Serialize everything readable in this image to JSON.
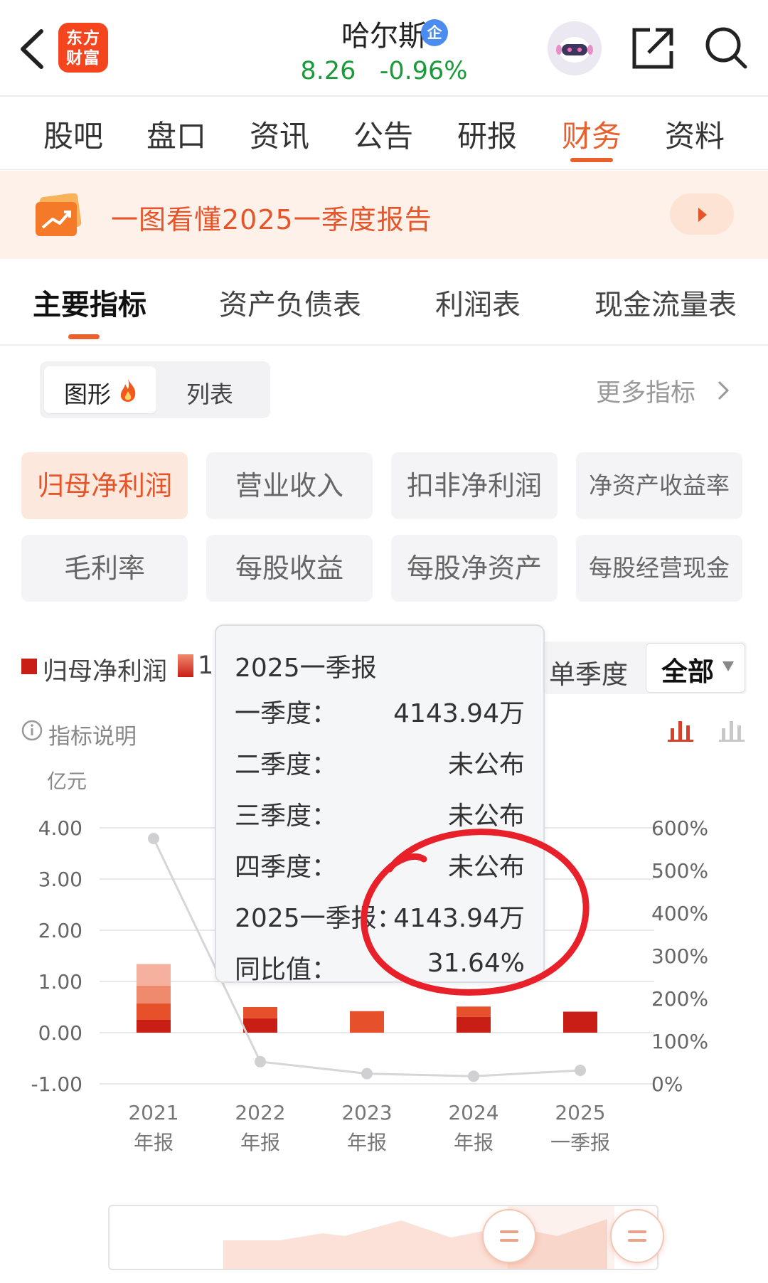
{
  "header": {
    "logo_line1": "东方",
    "logo_line2": "财富",
    "stock_name": "哈尔斯",
    "enterprise_badge": "企",
    "price": "8.26",
    "change": "-0.96%",
    "icons": [
      "back-icon",
      "robot-avatar-icon",
      "share-icon",
      "search-icon"
    ]
  },
  "tabs": [
    {
      "label": "股吧"
    },
    {
      "label": "盘口"
    },
    {
      "label": "资讯"
    },
    {
      "label": "公告"
    },
    {
      "label": "研报"
    },
    {
      "label": "财务",
      "active": true
    },
    {
      "label": "资料"
    }
  ],
  "banner": {
    "text": "一图看懂2025一季度报告"
  },
  "subtabs": [
    {
      "label": "主要指标",
      "active": true
    },
    {
      "label": "资产负债表"
    },
    {
      "label": "利润表"
    },
    {
      "label": "现金流量表"
    }
  ],
  "view_toggle": {
    "graph": "图形",
    "list": "列表",
    "selected": "graph"
  },
  "more_metrics": "更多指标",
  "metrics": [
    {
      "label": "归母净利润",
      "active": true
    },
    {
      "label": "营业收入"
    },
    {
      "label": "扣非净利润"
    },
    {
      "label": "净资产收益率"
    },
    {
      "label": "毛利率"
    },
    {
      "label": "每股收益"
    },
    {
      "label": "每股净资产"
    },
    {
      "label": "每股经营现金"
    }
  ],
  "legend": {
    "series1": "归母净利润",
    "series2_partial": "1"
  },
  "period": {
    "single": "单季度",
    "all": "全部"
  },
  "indicator_note": "指标说明",
  "colors": {
    "accent": "#e8612c",
    "green": "#1a9a3a",
    "q1": "#c81e16",
    "q2": "#e6502a",
    "q3": "#f08a6c",
    "q4": "#f6b09e",
    "line": "#d6d6d6"
  },
  "chart_data": {
    "type": "bar",
    "y_unit": "亿元",
    "y_ticks": [
      "4.00",
      "3.00",
      "2.00",
      "1.00",
      "0.00",
      "-1.00"
    ],
    "ylim": [
      -1,
      4
    ],
    "y2_ticks": [
      "600%",
      "500%",
      "400%",
      "300%",
      "200%",
      "100%",
      "0%"
    ],
    "y2lim": [
      0,
      600
    ],
    "categories": [
      [
        "2021",
        "年报"
      ],
      [
        "2022",
        "年报"
      ],
      [
        "2023",
        "年报"
      ],
      [
        "2024",
        "年报"
      ],
      [
        "2025",
        "一季报"
      ]
    ],
    "stack_series": [
      {
        "name": "一季度",
        "values": [
          0.25,
          0.28,
          0.0,
          0.31,
          0.41
        ]
      },
      {
        "name": "二季度",
        "values": [
          0.32,
          0.22,
          0.42,
          0.2,
          0
        ]
      },
      {
        "name": "三季度",
        "values": [
          0.35,
          0,
          0,
          0,
          0
        ]
      },
      {
        "name": "四季度",
        "values": [
          0.42,
          0,
          0,
          0,
          0
        ]
      }
    ],
    "yoy_line": {
      "values": [
        575,
        52,
        24,
        18,
        31.64
      ]
    }
  },
  "tooltip": {
    "title": "2025一季报",
    "rows": [
      {
        "label": "一季度：",
        "value": "4143.94万"
      },
      {
        "label": "二季度：",
        "value": "未公布"
      },
      {
        "label": "三季度：",
        "value": "未公布"
      },
      {
        "label": "四季度：",
        "value": "未公布"
      },
      {
        "label": "2025一季报：",
        "value": "4143.94万"
      },
      {
        "label": "同比值：",
        "value": "31.64%"
      }
    ]
  }
}
